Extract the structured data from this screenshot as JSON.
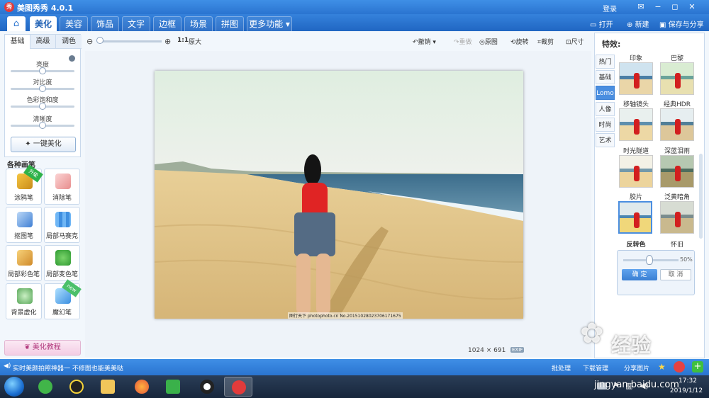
{
  "window": {
    "title": "美图秀秀 4.0.1",
    "logo_text": "秀",
    "login": "登录",
    "controls": [
      "✉",
      "−",
      "◻",
      "✕"
    ]
  },
  "menu": {
    "tabs": [
      {
        "label": "美化",
        "active": true
      },
      {
        "label": "美容",
        "active": false
      },
      {
        "label": "饰品",
        "active": false
      },
      {
        "label": "文字",
        "active": false
      },
      {
        "label": "边框",
        "active": false
      },
      {
        "label": "场景",
        "active": false
      },
      {
        "label": "拼图",
        "active": false
      },
      {
        "label": "更多功能 ▾",
        "active": false
      }
    ],
    "open": "打开",
    "new": "新建",
    "save_share": "保存与分享"
  },
  "left": {
    "subtabs": [
      "基础",
      "高级",
      "调色"
    ],
    "sliders": [
      {
        "label": "亮度",
        "value": 0.5
      },
      {
        "label": "对比度",
        "value": 0.5
      },
      {
        "label": "色彩饱和度",
        "value": 0.5
      },
      {
        "label": "清晰度",
        "value": 0.5
      }
    ],
    "one_click": "一键美化",
    "brushes_title": "各种画笔",
    "brushes": [
      {
        "label": "涂鸦笔",
        "badge": "升级"
      },
      {
        "label": "消除笔",
        "badge": ""
      },
      {
        "label": "抠图笔",
        "badge": ""
      },
      {
        "label": "局部马赛克",
        "badge": ""
      },
      {
        "label": "局部彩色笔",
        "badge": ""
      },
      {
        "label": "局部变色笔",
        "badge": ""
      },
      {
        "label": "背景虚化",
        "badge": ""
      },
      {
        "label": "魔幻笔",
        "badge": "new"
      }
    ],
    "tutorial": "美化教程"
  },
  "toolbar": {
    "zoom_ratio": "1:1",
    "zoom_fit": "原大",
    "undo": "撤销",
    "redo": "重做",
    "original": "原图",
    "rotate": "旋转",
    "crop": "裁剪",
    "size": "尺寸"
  },
  "canvas": {
    "watermark": "图行天下 photophoto.cn  No.20151028023706171675",
    "image_size": "1024 × 691",
    "exif": "EXIF"
  },
  "right": {
    "title": "特效:",
    "categories": [
      "热门",
      "基础",
      "Lomo",
      "人像",
      "时尚",
      "艺术"
    ],
    "active_category": "Lomo",
    "effects": [
      {
        "name": "印象"
      },
      {
        "name": "巴黎"
      },
      {
        "name": "移轴镜头"
      },
      {
        "name": "经典HDR"
      },
      {
        "name": "时光隧道"
      },
      {
        "name": "深蓝泪雨"
      },
      {
        "name": "胶片"
      },
      {
        "name": "泛黄暗角"
      },
      {
        "name": "反转色"
      },
      {
        "name": "怀旧"
      }
    ],
    "selected_effect": "反转色",
    "intensity": "50%",
    "ok": "确 定",
    "cancel": "取 消"
  },
  "status": {
    "text": "实时美颜拍照神器一 不修图也能美美哒",
    "batch": "批处理",
    "download": "下载管理",
    "share": "分享图片"
  },
  "taskbar": {
    "time": "17:32",
    "date": "2019/1/12"
  },
  "watermark": {
    "brand": "经验",
    "url": "jingyan.baidu.com"
  }
}
